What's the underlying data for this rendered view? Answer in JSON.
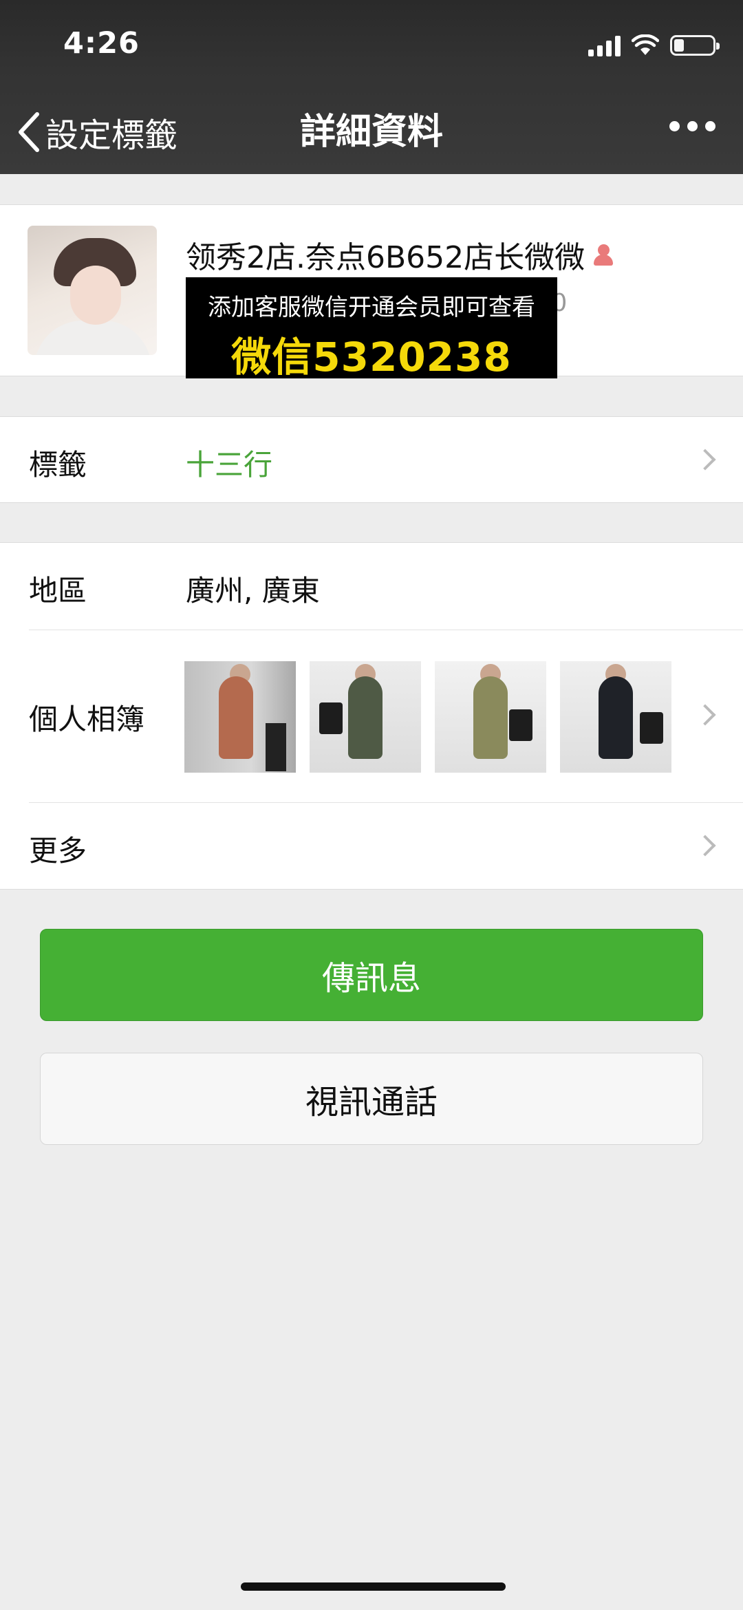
{
  "status_bar": {
    "time": "4:26"
  },
  "nav": {
    "back_label": "設定標籤",
    "title": "詳細資料"
  },
  "profile": {
    "name": "领秀2店.奈点6B652店长微微",
    "id_tail": ".0"
  },
  "overlay": {
    "line1": "添加客服微信开通会员即可查看",
    "line2": "微信5320238"
  },
  "tags_row": {
    "label": "標籤",
    "value": "十三行",
    "value_color": "#4aa43a"
  },
  "region_row": {
    "label": "地區",
    "value": "廣州, 廣東"
  },
  "album_row": {
    "label": "個人相簿",
    "photos": [
      {
        "outfit": "tan overalls"
      },
      {
        "outfit": "olive overalls with black bag"
      },
      {
        "outfit": "khaki overalls with black bag"
      },
      {
        "outfit": "black overalls with black bag"
      }
    ]
  },
  "more_row": {
    "label": "更多"
  },
  "buttons": {
    "message": "傳訊息",
    "video_call": "視訊通話"
  },
  "colors": {
    "accent_green": "#45b034",
    "header_bg": "#333333",
    "overlay_text": "#f5d90a"
  }
}
